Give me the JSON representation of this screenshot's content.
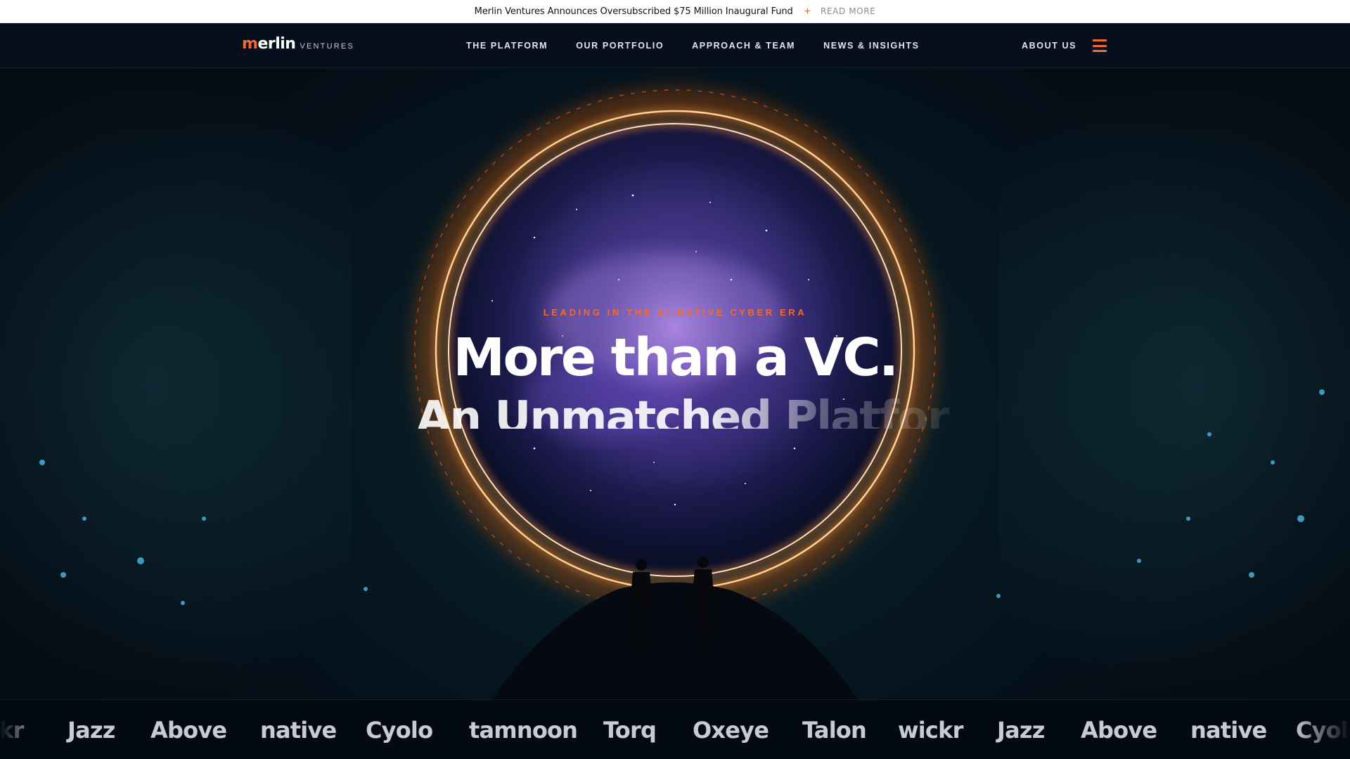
{
  "announcement": {
    "message": "Merlin Ventures Announces Oversubscribed $75 Million Inaugural Fund",
    "plus": "+",
    "link": "READ MORE"
  },
  "nav": {
    "logo_word_first": "m",
    "logo_word_rest": "erlin",
    "logo_sub": "VENTURES",
    "links": [
      "THE PLATFORM",
      "OUR PORTFOLIO",
      "APPROACH & TEAM",
      "NEWS & INSIGHTS"
    ],
    "about": "ABOUT US",
    "menu_icon": "hamburger-menu-icon",
    "accent": "#f26a2e"
  },
  "hero": {
    "eyebrow": "LEADING IN THE AI-NATIVE CYBER ERA",
    "headline": "More than a VC.",
    "subline": "An Unmatched Platform"
  },
  "portfolio_strip": {
    "items": [
      "kr",
      "Jazz",
      "Above",
      "native",
      "Cyolo",
      "tamnoon",
      "Torq",
      "Oxeye",
      "Talon",
      "wickr",
      "Jazz",
      "Above",
      "native",
      "Cyolo"
    ]
  }
}
